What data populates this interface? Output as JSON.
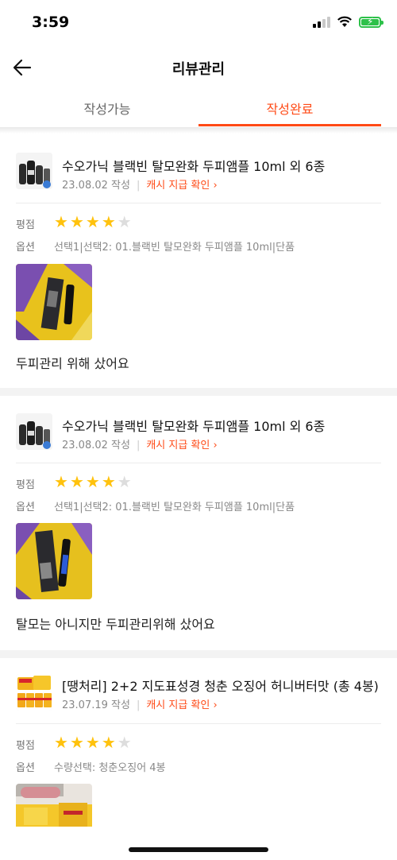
{
  "status": {
    "time": "3:59"
  },
  "header": {
    "title": "리뷰관리"
  },
  "tabs": [
    {
      "label": "작성가능",
      "active": false
    },
    {
      "label": "작성완료",
      "active": true
    }
  ],
  "labels": {
    "rating": "평점",
    "option": "옵션"
  },
  "reviews": [
    {
      "product": "수오가닉 블랙빈 탈모완화 두피앰플 10ml 외 6종",
      "date": "23.08.02 작성",
      "cash": "캐시 지급 확인 ›",
      "rating": 4,
      "option": "선택1|선택2: 01.블랙빈 탈모완화 두피앰플 10ml|단품",
      "comment": "두피관리 위해 샀어요"
    },
    {
      "product": "수오가닉 블랙빈 탈모완화 두피앰플 10ml 외 6종",
      "date": "23.08.02 작성",
      "cash": "캐시 지급 확인 ›",
      "rating": 4,
      "option": "선택1|선택2: 01.블랙빈 탈모완화 두피앰플 10ml|단품",
      "comment": "탈모는 아니지만 두피관리위해 샀어요"
    },
    {
      "product": "[땡처리] 2+2 지도표성경 청춘 오징어 허니버터맛 (총 4봉)",
      "date": "23.07.19 작성",
      "cash": "캐시 지급 확인 ›",
      "rating": 4,
      "option": "수량선택: 청춘오징어 4봉",
      "comment": ""
    }
  ],
  "colors": {
    "accent": "#ff4a16",
    "star": "#ffc20d"
  }
}
